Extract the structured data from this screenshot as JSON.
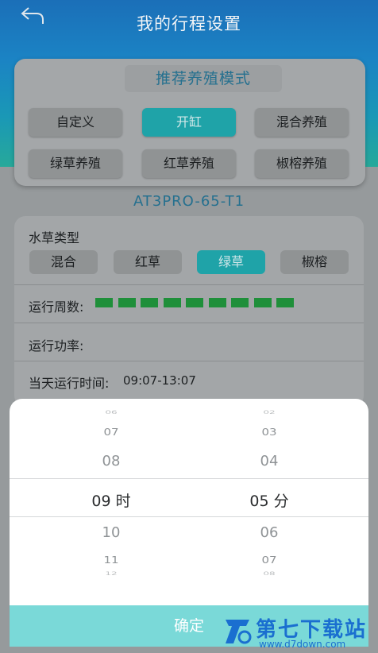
{
  "header": {
    "title": "我的行程设置",
    "back_icon": "back-arrow-icon"
  },
  "mode_card": {
    "title": "推荐养殖模式",
    "buttons": [
      "自定义",
      "开缸",
      "混合养殖",
      "绿草养殖",
      "红草养殖",
      "椒榕养殖"
    ],
    "active": "开缸"
  },
  "device_name": "AT3PRO-65-T1",
  "settings": {
    "grass_type_label": "水草类型",
    "grass_types": [
      "混合",
      "红草",
      "绿草",
      "椒榕"
    ],
    "grass_active": "绿草",
    "run_week_label": "运行周数:",
    "run_week_count": 9,
    "run_power_label": "运行功率:",
    "run_time_label": "当天运行时间:",
    "run_time_value": "09:07-13:07"
  },
  "picker": {
    "hours": [
      "06",
      "07",
      "08",
      "09 时",
      "10",
      "11",
      "12"
    ],
    "minutes": [
      "02",
      "03",
      "04",
      "05 分",
      "06",
      "07",
      "08"
    ],
    "confirm_label": "确定"
  },
  "watermark": {
    "title": "第七下载站",
    "url": "www.d7down.com"
  },
  "colors": {
    "accent": "#1fa3a8",
    "week_dot": "#1f8f3a",
    "confirm": "#7ad9d8"
  }
}
